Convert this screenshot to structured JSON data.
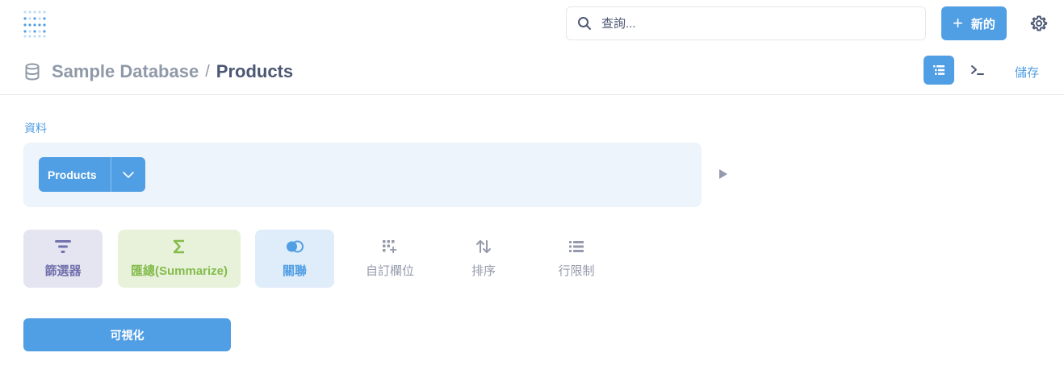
{
  "header": {
    "logo_icon": "metabase-logo-icon",
    "search": {
      "placeholder": "查詢...",
      "icon": "search-icon"
    },
    "new_button": {
      "label": "新的",
      "icon": "plus-icon"
    },
    "settings_icon": "gear-icon"
  },
  "breadcrumb": {
    "icon": "database-icon",
    "database": "Sample Database",
    "separator": "/",
    "table": "Products"
  },
  "toolbar": {
    "notebook_icon": "notebook-icon",
    "sql_icon": "sql-terminal-icon",
    "save_label": "儲存"
  },
  "data_section": {
    "label": "資料",
    "table_name": "Products",
    "dropdown_icon": "chevron-down-icon",
    "preview_icon": "play-icon"
  },
  "steps": {
    "filter": "篩選器",
    "summarize": "匯總(Summarize)",
    "join": "關聯",
    "custom_column": "自訂欄位",
    "sort": "排序",
    "limit": "行限制"
  },
  "visualize_label": "可視化",
  "colors": {
    "brand": "#509ee3",
    "filter": "#7172ad",
    "summarize": "#84bb4c",
    "text_dark": "#4c5773",
    "text_light": "#949aab"
  }
}
